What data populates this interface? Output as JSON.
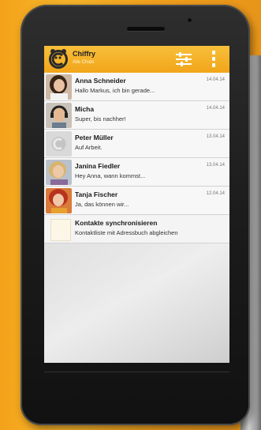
{
  "app": {
    "title": "Chiffry",
    "subtitle": "Alle Chats"
  },
  "chats": [
    {
      "name": "Anna Schneider",
      "message": "Hallo Markus, ich bin gerade...",
      "time": "14.04.14",
      "avatar": "photo-woman-dark-hair"
    },
    {
      "name": "Micha",
      "message": "Super, bis nachher!",
      "time": "14.04.14",
      "avatar": "photo-man-headphones"
    },
    {
      "name": "Peter Müller",
      "message": "Auf Arbeit.",
      "time": "13.04.14",
      "avatar": "default-user-icon"
    },
    {
      "name": "Janina Fiedler",
      "message": "Hey Anna, wann kommst...",
      "time": "13.04.14",
      "avatar": "photo-woman-blonde"
    },
    {
      "name": "Tanja Fischer",
      "message": "Ja, das können wir...",
      "time": "12.04.14",
      "avatar": "photo-woman-red-hair"
    }
  ],
  "sync": {
    "title": "Kontakte synchronisieren",
    "subtitle": "Kontaktliste mit Adressbuch abgleichen"
  },
  "colors": {
    "appbar": "#f1a51a",
    "background": "#f3a21a",
    "phone": "#1c1c1c"
  }
}
